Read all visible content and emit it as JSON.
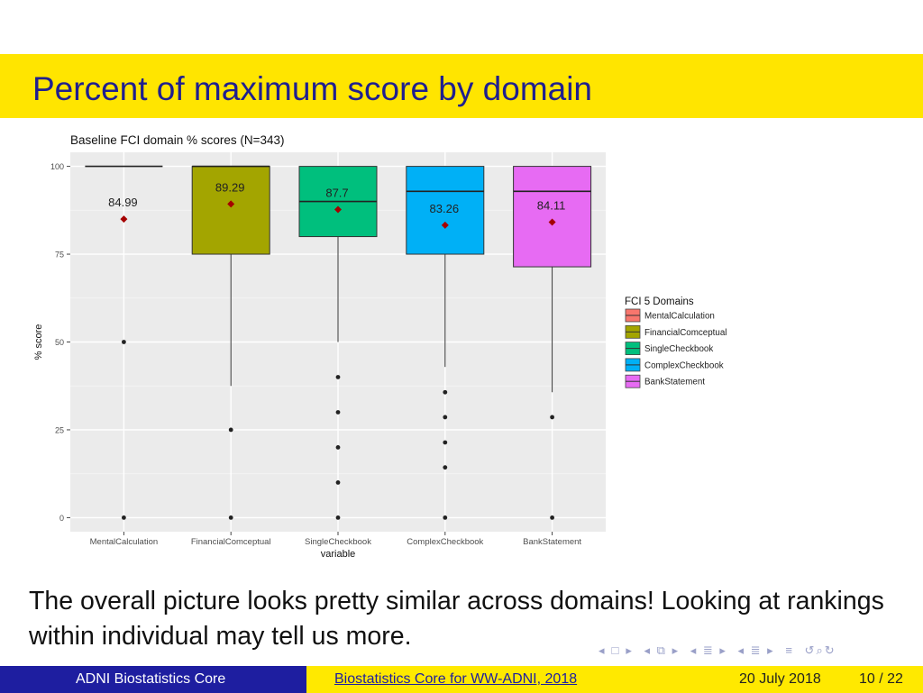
{
  "slide": {
    "title": "Percent of maximum score by domain",
    "body": "The overall picture looks pretty similar across domains! Looking at rankings within individual may tell us more."
  },
  "colors": {
    "title_bar": "#ffe500",
    "title_text": "#1f1f8f",
    "footer_blue": "#1e1ea0",
    "footer_yellow": "#ffe900",
    "panel_bg": "#ebebeb",
    "mean_marker": "#a50000"
  },
  "footer": {
    "left": "ADNI Biostatistics Core",
    "center": "Biostatistics Core for WW-ADNI, 2018",
    "date": "20 July 2018",
    "page": "10 / 22"
  },
  "nav_icons": [
    "prev-arrow-icon",
    "frame-icon",
    "next-arrow-icon",
    "prev-frame-icon",
    "subsection-icon",
    "next-subsection-icon",
    "section-icon",
    "align-icon",
    "search-icon"
  ],
  "chart_data": {
    "type": "box",
    "title": "Baseline FCI domain % scores (N=343)",
    "xlabel": "variable",
    "ylabel": "% score",
    "ylim": [
      -4,
      104
    ],
    "yticks": [
      0,
      25,
      50,
      75,
      100
    ],
    "grid": true,
    "legend": {
      "title": "FCI 5 Domains",
      "position": "right"
    },
    "categories": [
      "MentalCalculation",
      "FinancialComceptual",
      "SingleCheckbook",
      "ComplexCheckbook",
      "BankStatement"
    ],
    "series": [
      {
        "name": "MentalCalculation",
        "color": "#f8766d",
        "q1": 100,
        "median": 100,
        "q3": 100,
        "whisker_low": 100,
        "whisker_high": 100,
        "mean": 84.99,
        "mean_label": "84.99",
        "outliers": [
          50,
          0
        ]
      },
      {
        "name": "FinancialComceptual",
        "color": "#a3a500",
        "q1": 75,
        "median": 100,
        "q3": 100,
        "whisker_low": 37.5,
        "whisker_high": 100,
        "mean": 89.29,
        "mean_label": "89.29",
        "outliers": [
          25,
          0
        ]
      },
      {
        "name": "SingleCheckbook",
        "color": "#00bf7d",
        "q1": 80,
        "median": 90,
        "q3": 100,
        "whisker_low": 50,
        "whisker_high": 100,
        "mean": 87.7,
        "mean_label": "87.7",
        "outliers": [
          40,
          30,
          20,
          10,
          0
        ]
      },
      {
        "name": "ComplexCheckbook",
        "color": "#00b0f6",
        "q1": 75,
        "median": 92.9,
        "q3": 100,
        "whisker_low": 42.9,
        "whisker_high": 100,
        "mean": 83.26,
        "mean_label": "83.26",
        "outliers": [
          35.7,
          28.6,
          21.4,
          14.3,
          0
        ]
      },
      {
        "name": "BankStatement",
        "color": "#e76bf3",
        "q1": 71.4,
        "median": 92.9,
        "q3": 100,
        "whisker_low": 35.7,
        "whisker_high": 100,
        "mean": 84.11,
        "mean_label": "84.11",
        "outliers": [
          28.6,
          0
        ]
      }
    ]
  }
}
